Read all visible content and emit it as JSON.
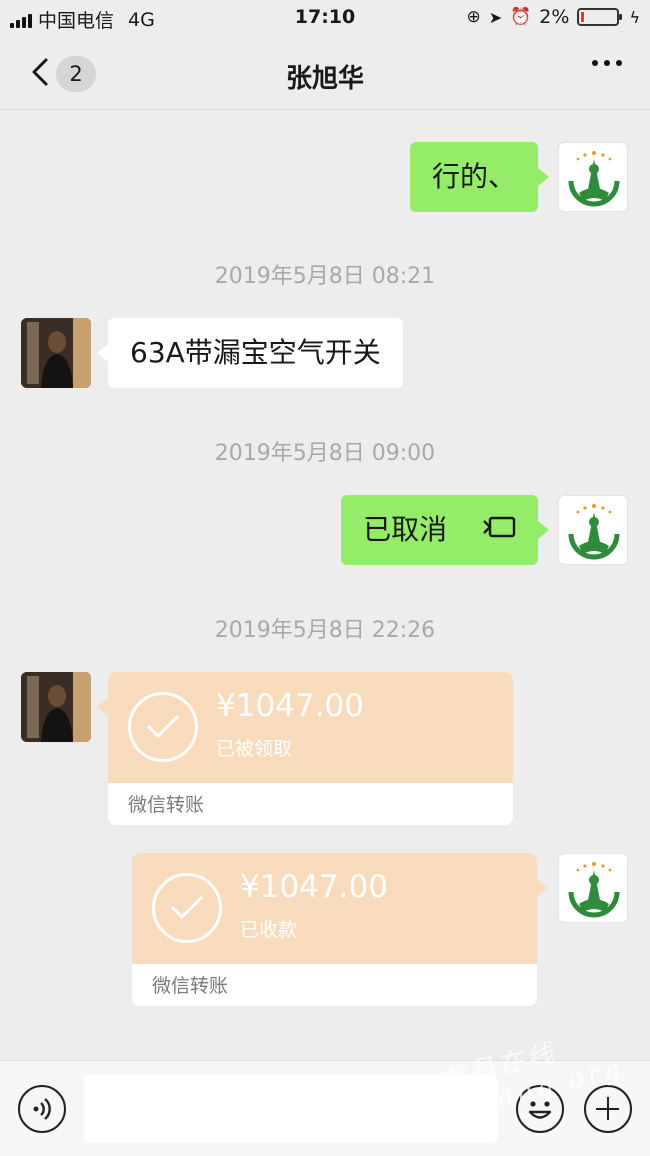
{
  "status_bar": {
    "carrier": "中国电信",
    "network": "4G",
    "time": "17:10",
    "battery": "2%"
  },
  "nav": {
    "unread_count": "2",
    "title": "张旭华"
  },
  "messages": [
    {
      "id": "m1",
      "from": "self",
      "text": "行的、"
    },
    {
      "id": "t1",
      "timestamp": "2019年5月8日 08:21"
    },
    {
      "id": "m2",
      "from": "other",
      "text": "63A带漏宝空气开关"
    },
    {
      "id": "t2",
      "timestamp": "2019年5月8日 09:00"
    },
    {
      "id": "m3",
      "from": "self",
      "text": "已取消",
      "icon": "voice-call-icon"
    },
    {
      "id": "t3",
      "timestamp": "2019年5月8日 22:26"
    },
    {
      "id": "m4",
      "from": "other",
      "type": "transfer",
      "amount": "¥1047.00",
      "status": "已被领取",
      "label": "微信转账"
    },
    {
      "id": "m5",
      "from": "self",
      "type": "transfer",
      "amount": "¥1047.00",
      "status": "已收款",
      "label": "微信转账"
    }
  ],
  "watermark": "龙昌在线 lchang.org",
  "colors": {
    "self_bubble": "#95ec69",
    "other_bubble": "#ffffff",
    "transfer_card": "#f8dcbd",
    "background": "#ededed"
  }
}
